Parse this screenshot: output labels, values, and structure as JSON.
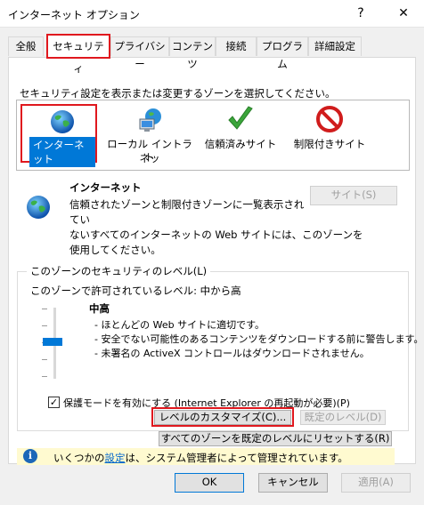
{
  "window": {
    "title": "インターネット オプション",
    "help_glyph": "?",
    "close_glyph": "✕"
  },
  "tabs": [
    {
      "label": "全般"
    },
    {
      "label": "セキュリティ",
      "active": true
    },
    {
      "label": "プライバシー"
    },
    {
      "label": "コンテンツ"
    },
    {
      "label": "接続"
    },
    {
      "label": "プログラム"
    },
    {
      "label": "詳細設定"
    }
  ],
  "security": {
    "instruction": "セキュリティ設定を表示または変更するゾーンを選択してください。",
    "zones": [
      {
        "label": "インターネット",
        "icon": "globe-icon",
        "selected": true
      },
      {
        "label_line1": "ローカル イントラネッ",
        "label_line2": "ト",
        "icon": "intranet-icon"
      },
      {
        "label": "信頼済みサイト",
        "icon": "checkmark-icon"
      },
      {
        "label": "制限付きサイト",
        "icon": "restricted-icon"
      }
    ],
    "zone_title": "インターネット",
    "zone_description_lines": [
      "信頼されたゾーンと制限付きゾーンに一覧表示されてい",
      "ないすべてのインターネットの Web サイトには、このゾーンを",
      "使用してください。"
    ],
    "sites_button": "サイト(S)"
  },
  "level_group": {
    "legend": "このゾーンのセキュリティのレベル(L)",
    "allowed_text": "このゾーンで許可されているレベル: 中から高",
    "level_name": "中高",
    "bullets": [
      "- ほとんどの Web サイトに適切です。",
      "- 安全でない可能性のあるコンテンツをダウンロードする前に警告します。",
      "- 未署名の ActiveX コントロールはダウンロードされません。"
    ],
    "protected_mode_label": "保護モードを有効にする (Internet Explorer の再起動が必要)(P)",
    "protected_mode_checked": true,
    "custom_level_button": "レベルのカスタマイズ(C)...",
    "default_level_button": "既定のレベル(D)"
  },
  "reset_all_button": "すべてのゾーンを既定のレベルにリセットする(R)",
  "info": {
    "text_before": "いくつかの",
    "link": "設定",
    "text_after": "は、システム管理者によって管理されています。"
  },
  "footer": {
    "ok": "OK",
    "cancel": "キャンセル",
    "apply": "適用(A)"
  },
  "colors": {
    "highlight": "#e0181e",
    "selection": "#0078d7",
    "info_bg": "#fffad0"
  }
}
